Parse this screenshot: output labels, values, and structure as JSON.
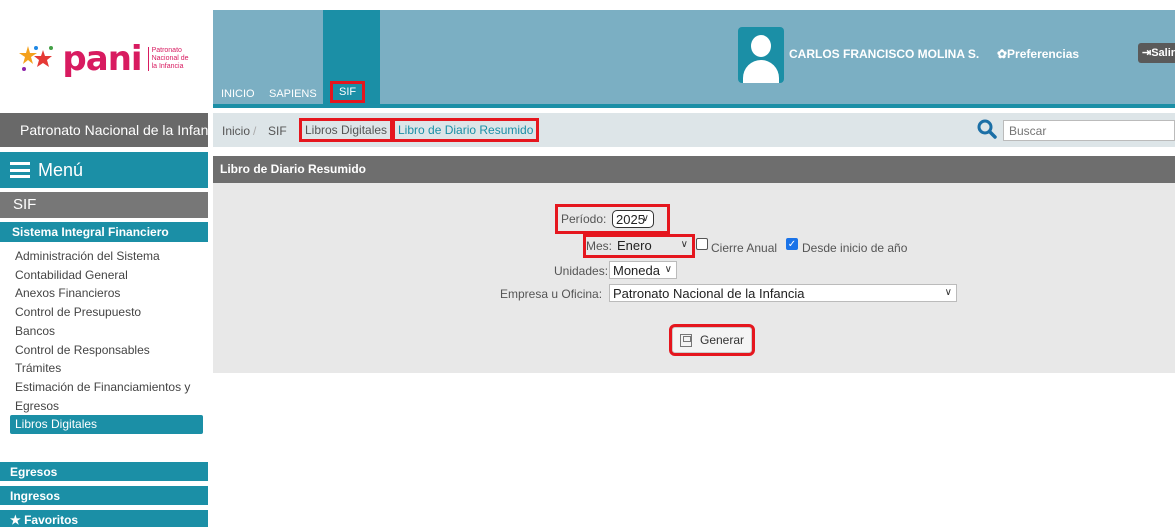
{
  "brand": {
    "logo_text": "pani",
    "logo_subtitle": "Patronato Nacional de la Infancia",
    "org_name": "Patronato Nacional de la Infancia",
    "accent_color": "#1b8fa6",
    "logo_color": "#d81b60"
  },
  "sidebar": {
    "menu_label": "Menú",
    "module": "SIF",
    "group_title": "Sistema Integral Financiero",
    "items": [
      {
        "label": "Administración del Sistema"
      },
      {
        "label": "Contabilidad General"
      },
      {
        "label": "Anexos Financieros"
      },
      {
        "label": "Control de Presupuesto"
      },
      {
        "label": "Bancos"
      },
      {
        "label": "Control de Responsables"
      },
      {
        "label": "Trámites"
      },
      {
        "label": "Estimación de Financiamientos y"
      },
      {
        "label": "Egresos"
      },
      {
        "label": "Libros Digitales"
      }
    ],
    "groups": [
      "Egresos",
      "Ingresos",
      "★ Favoritos"
    ]
  },
  "header": {
    "nav": [
      "INICIO",
      "SAPIENS",
      "SIF"
    ],
    "user_name": "CARLOS FRANCISCO MOLINA S.",
    "preferences": "✿Preferencias",
    "exit": "⇥Salir"
  },
  "breadcrumb": {
    "items": [
      "Inicio",
      "/",
      "SIF",
      "Libros Digitales",
      "Libro de Diario Resumido"
    ],
    "search_placeholder": "Buscar"
  },
  "form": {
    "panel_title": "Libro de Diario Resumido",
    "periodo_label": "Período:",
    "periodo_value": "2025",
    "mes_label": "Mes:",
    "mes_value": "Enero",
    "cierre_label": "Cierre Anual",
    "desde_label": "Desde inicio de año",
    "unidades_label": "Unidades:",
    "unidades_value": "Moneda",
    "empresa_label": "Empresa u Oficina:",
    "empresa_value": "Patronato Nacional de la Infancia",
    "generate_label": "Generar"
  }
}
